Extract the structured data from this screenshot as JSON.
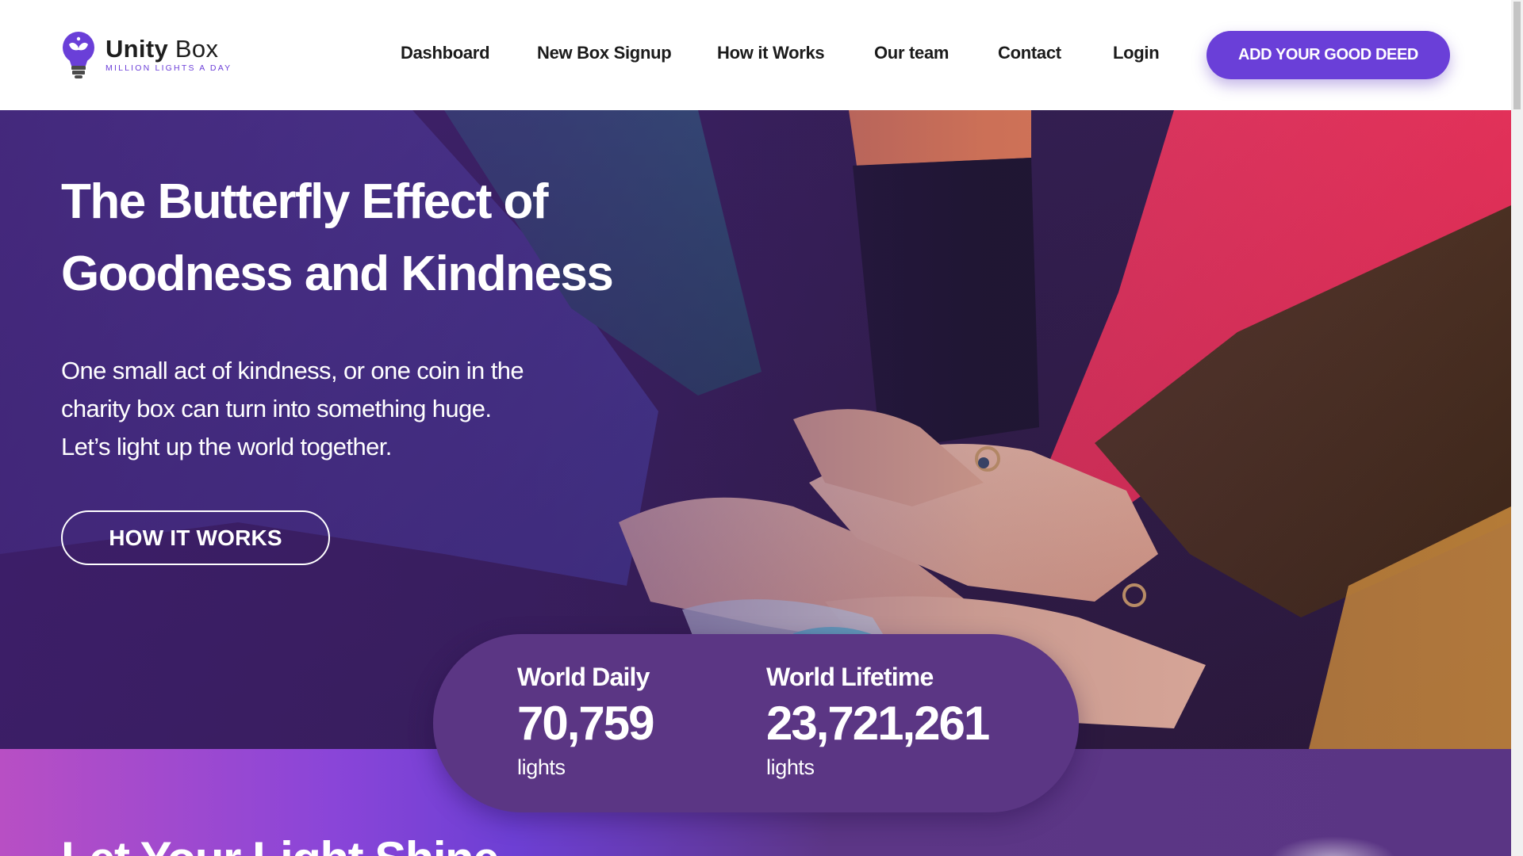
{
  "brand": {
    "name_bold": "Unity",
    "name_light": "Box",
    "tagline": "MILLION LIGHTS A DAY",
    "logo_icon": "lightbulb-logo-icon",
    "accent_color": "#6a3fd8"
  },
  "nav": {
    "items": [
      {
        "label": "Dashboard"
      },
      {
        "label": "New Box Signup"
      },
      {
        "label": "How it Works"
      },
      {
        "label": "Our team"
      },
      {
        "label": "Contact"
      },
      {
        "label": "Login"
      }
    ],
    "cta_label": "ADD YOUR GOOD DEED"
  },
  "hero": {
    "title_line1": "The Butterfly Effect of",
    "title_line2": "Goodness and Kindness",
    "desc_line1": "One small act of kindness, or one coin in the",
    "desc_line2": "charity box can turn into something huge.",
    "desc_line3": "Let’s light up the world together.",
    "button_label": "HOW IT WORKS",
    "image": "stacked-hands-in-knit-sweaters-photo"
  },
  "stats": {
    "daily": {
      "label": "World Daily",
      "value": "70,759",
      "unit": "lights"
    },
    "lifetime": {
      "label": "World Lifetime",
      "value": "23,721,261",
      "unit": "lights"
    }
  },
  "section": {
    "title": "Let Your Light Shine"
  }
}
